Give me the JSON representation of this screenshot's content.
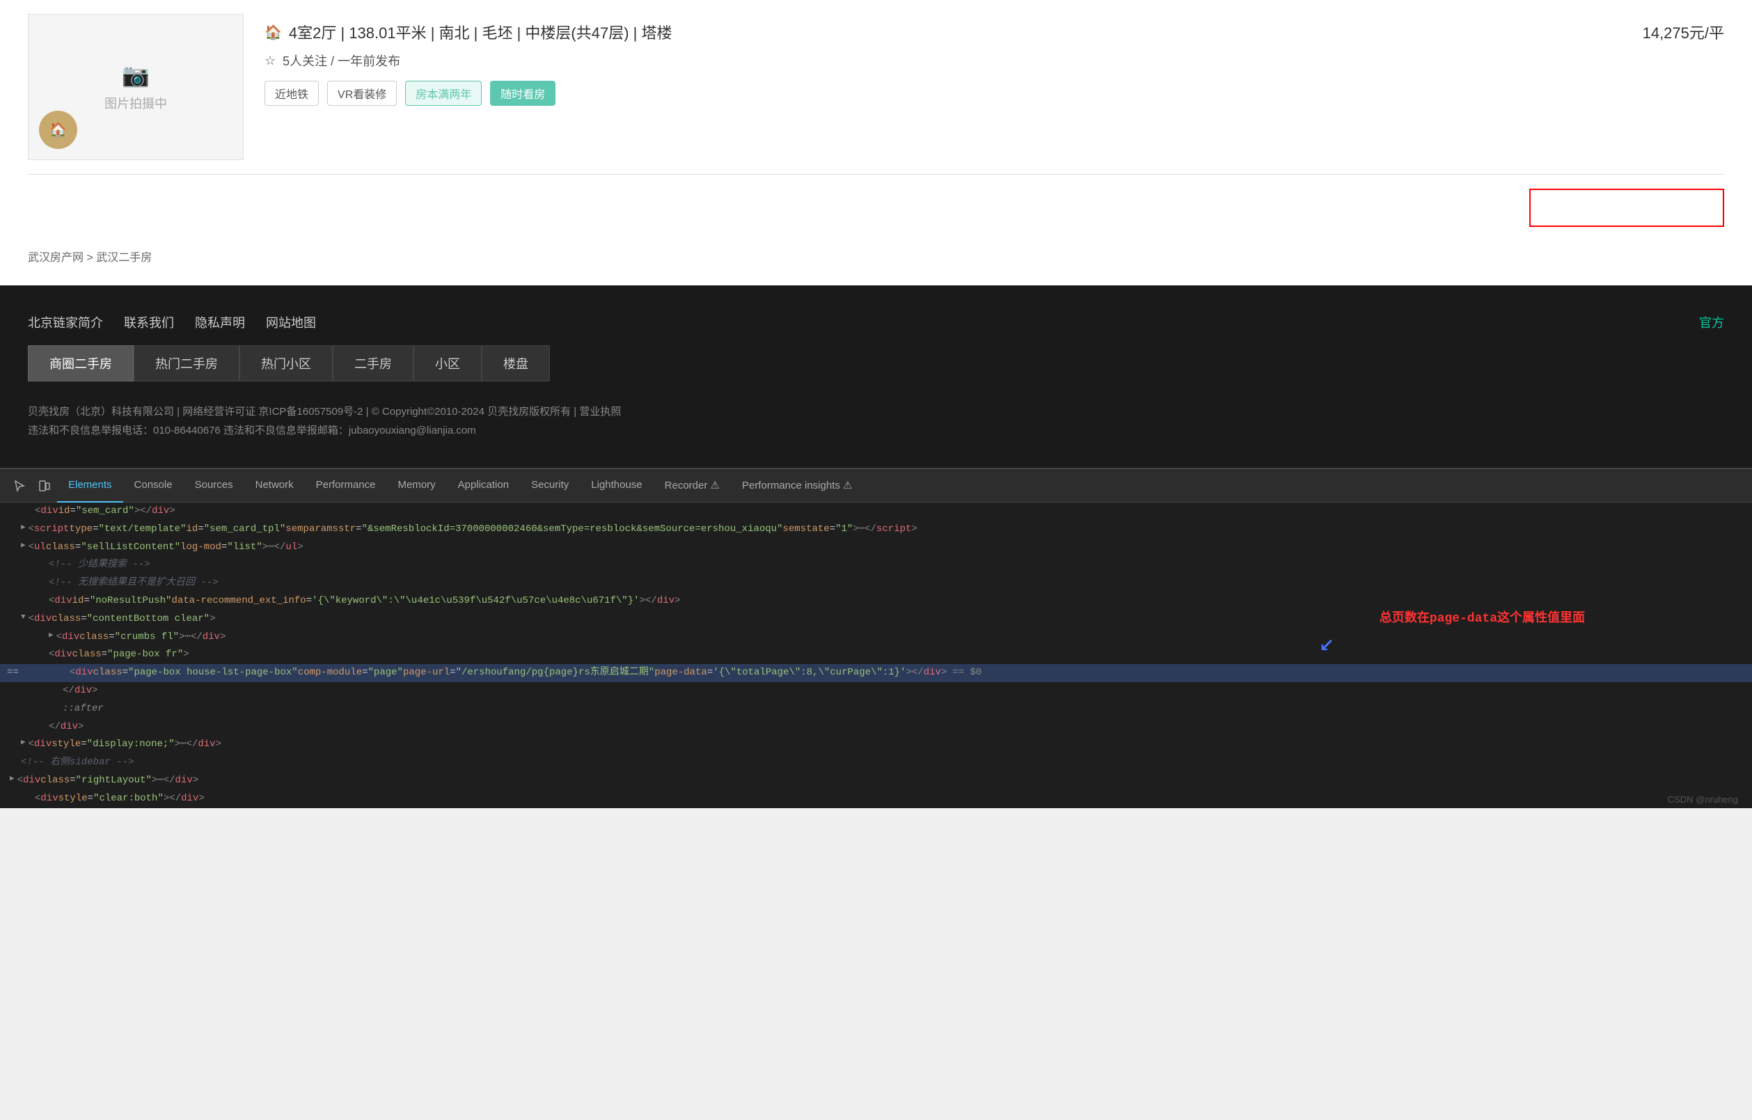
{
  "website": {
    "property": {
      "camera_icon": "📷",
      "photo_text": "图片拍摄中",
      "avatar_icon": "🏠",
      "details": "4室2厅 | 138.01平米 | 南北 | 毛坯 | 中楼层(共47层) | 塔楼",
      "price": "14,275元/平",
      "meta": "5人关注 / 一年前发布",
      "tags": [
        "近地铁",
        "VR看装修",
        "房本满两年",
        "随时看房"
      ],
      "tag_types": [
        "normal",
        "normal",
        "green",
        "teal-fill"
      ]
    },
    "breadcrumb": "武汉房产网 > 武汉二手房"
  },
  "footer": {
    "nav_items": [
      "北京链家简介",
      "联系我们",
      "隐私声明",
      "网站地图"
    ],
    "nav_right": "官方",
    "tabs": [
      "商圈二手房",
      "热门二手房",
      "热门小区",
      "二手房",
      "小区",
      "楼盘"
    ],
    "active_tab_index": 0,
    "copyright": "贝壳找房（北京）科技有限公司 | 网络经营许可证 京ICP备16057509号-2 | © Copyright©2010-2024 贝壳找房版权所有 | 营业执照",
    "disclaimer": "违法和不良信息举报电话：010-86440676 违法和不良信息举报邮箱：jubaoyouxiang@lianjia.com"
  },
  "devtools": {
    "icon_buttons": [
      "cursor",
      "device"
    ],
    "tabs": [
      "Elements",
      "Console",
      "Sources",
      "Network",
      "Performance",
      "Memory",
      "Application",
      "Security",
      "Lighthouse",
      "Recorder ⚠",
      "Performance insights ⚠"
    ],
    "active_tab": "Elements",
    "code_lines": [
      {
        "indent": 4,
        "content": "<div id=\"sem_card\"></div>",
        "type": "element",
        "expanded": false
      },
      {
        "indent": 4,
        "content": "<script type=\"text/template\" id=\"sem_card_tpl\" semparamsstr=\"&semResblockId=37000000002460&semType=resblock&semSource=ershou_xiaoqu\" semstate=\"1\">",
        "type": "element",
        "has_expand": true
      },
      {
        "indent": 4,
        "content": "<ul class=\"sellListContent\" log-mod=\"list\">",
        "type": "element",
        "has_expand": true
      },
      {
        "indent": 6,
        "content": "<!-- 少结果搜索 -->",
        "type": "comment"
      },
      {
        "indent": 6,
        "content": "<!-- 无搜索结果且不是扩大召回 -->",
        "type": "comment"
      },
      {
        "indent": 6,
        "content": "<div id=\"noResultPush\" data-recommend_ext_info='{\"keyword\":\"东原启城二期\"}'></div>",
        "type": "element"
      },
      {
        "indent": 4,
        "content": "<div class=\"contentBottom clear\">",
        "type": "element",
        "expanded": true
      },
      {
        "indent": 6,
        "content": "<div class=\"crumbs fl\">",
        "type": "element",
        "has_expand": true
      },
      {
        "indent": 6,
        "content": "<div class=\"page-box fr\">",
        "type": "element"
      },
      {
        "indent": 8,
        "content": "<div class=\"page-box house-lst-page-box\" comp-module=\"page\" page-url=\"/ershoufang/pg{page}rs东原启城二期\" page-data='{\"totalPage\":8,\"curPage\":1}'></div>",
        "type": "element_selected"
      },
      {
        "indent": 8,
        "content": "</div>",
        "type": "element"
      },
      {
        "indent": 8,
        "content": "::after",
        "type": "pseudo"
      },
      {
        "indent": 6,
        "content": "</div>",
        "type": "element"
      },
      {
        "indent": 4,
        "content": "<div style=\"display:none;\">",
        "type": "element",
        "has_expand": true
      },
      {
        "indent": 4,
        "content": "<!-- 右侧sidebar -->",
        "type": "comment"
      },
      {
        "indent": 2,
        "content": "<div class=\"rightLayout\">",
        "type": "element",
        "has_expand": true
      },
      {
        "indent": 4,
        "content": "<div style=\"clear:both\"></div>",
        "type": "element"
      }
    ],
    "annotation_text": "总页数在page-data这个属性值里面",
    "csdn_text": "CSDN @nruheng",
    "selected_line_index": 9
  }
}
